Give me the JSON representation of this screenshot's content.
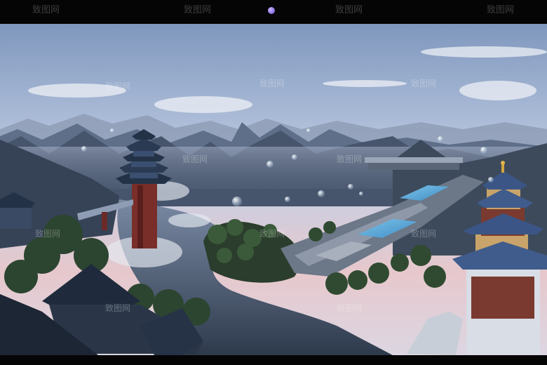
{
  "caption": "",
  "bottom_label": "",
  "watermark": "致图网",
  "colors": {
    "sky_top": "#7c93b8",
    "sky_mid": "#c8d2e6",
    "horizon_pink": "#e8c2c8",
    "mountain_far": "#5d6d88",
    "mountain_near": "#2e3a4a",
    "forest": "#2f4a30",
    "water": "#3c4a5c",
    "pool": "#58a8d8",
    "roof": "#1f2a3a",
    "tower_red": "#8a2f2a"
  },
  "icons": [
    "purple-orb-icon"
  ]
}
